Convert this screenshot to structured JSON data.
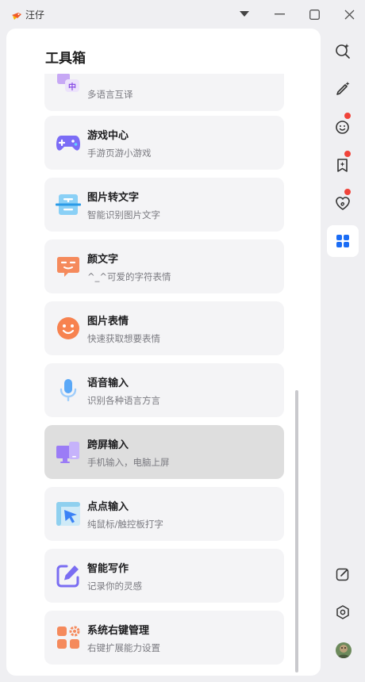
{
  "window": {
    "title": "汪仔",
    "controls": [
      "dropdown-icon",
      "minimize-icon",
      "maximize-icon",
      "close-icon"
    ]
  },
  "panel": {
    "title": "工具箱",
    "items": [
      {
        "title": "",
        "subtitle": "多语言互译",
        "icon": "translate-icon",
        "icon_glyph": "中",
        "active": false,
        "clipped": true
      },
      {
        "title": "游戏中心",
        "subtitle": "手游页游小游戏",
        "icon": "gamepad-icon",
        "active": false
      },
      {
        "title": "图片转文字",
        "subtitle": "智能识别图片文字",
        "icon": "image-to-text-icon",
        "active": false
      },
      {
        "title": "颜文字",
        "subtitle": "^_^可爱的字符表情",
        "icon": "kaomoji-icon",
        "active": false
      },
      {
        "title": "图片表情",
        "subtitle": "快速获取想要表情",
        "icon": "smile-face-icon",
        "active": false
      },
      {
        "title": "语音输入",
        "subtitle": "识别各种语言方言",
        "icon": "microphone-icon",
        "active": false
      },
      {
        "title": "跨屏输入",
        "subtitle": "手机输入，电脑上屏",
        "icon": "cross-screen-icon",
        "active": true
      },
      {
        "title": "点点输入",
        "subtitle": "纯鼠标/触控板打字",
        "icon": "click-input-icon",
        "active": false
      },
      {
        "title": "智能写作",
        "subtitle": "记录你的灵感",
        "icon": "smart-writing-icon",
        "active": false
      },
      {
        "title": "系统右键管理",
        "subtitle": "右键扩展能力设置",
        "icon": "context-menu-settings-icon",
        "active": false
      }
    ]
  },
  "rail": {
    "items": [
      {
        "icon": "ai-search-icon",
        "badge": false,
        "active": false
      },
      {
        "icon": "magic-pen-icon",
        "badge": false,
        "active": false
      },
      {
        "icon": "emoji-sparkle-icon",
        "badge": true,
        "active": false
      },
      {
        "icon": "bookmark-sparkle-icon",
        "badge": true,
        "active": false
      },
      {
        "icon": "heart-spiral-icon",
        "badge": true,
        "active": false
      },
      {
        "icon": "toolbox-grid-icon",
        "badge": false,
        "active": true
      }
    ],
    "bottom": [
      "edit-icon",
      "settings-hexagon-icon",
      "user-avatar"
    ]
  },
  "colors": {
    "accent": "#1a6cf5",
    "badge": "#f0433a",
    "active_card": "#dedede",
    "card": "#f4f4f6"
  }
}
